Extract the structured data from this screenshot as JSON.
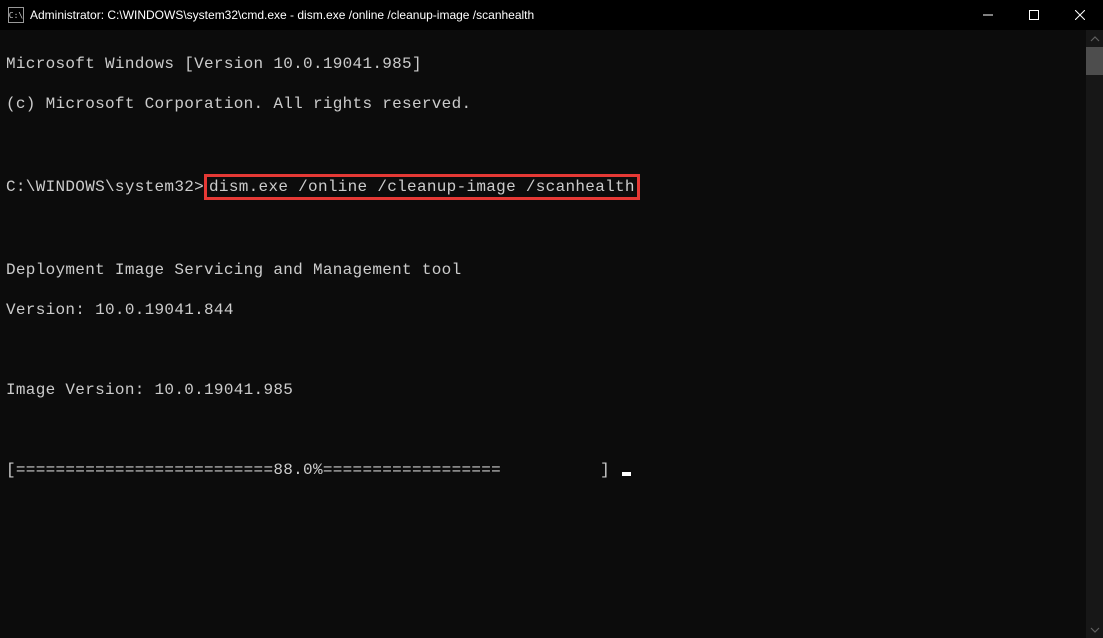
{
  "titlebar": {
    "icon_label": "cmd",
    "title": "Administrator: C:\\WINDOWS\\system32\\cmd.exe - dism.exe  /online /cleanup-image /scanhealth"
  },
  "terminal": {
    "line1": "Microsoft Windows [Version 10.0.19041.985]",
    "line2": "(c) Microsoft Corporation. All rights reserved.",
    "prompt_path": "C:\\WINDOWS\\system32>",
    "command": "dism.exe /online /cleanup-image /scanhealth",
    "tool_name": "Deployment Image Servicing and Management tool",
    "tool_version": "Version: 10.0.19041.844",
    "image_version": "Image Version: 10.0.19041.985",
    "progress_line": "[==========================88.0%==================          ] "
  }
}
